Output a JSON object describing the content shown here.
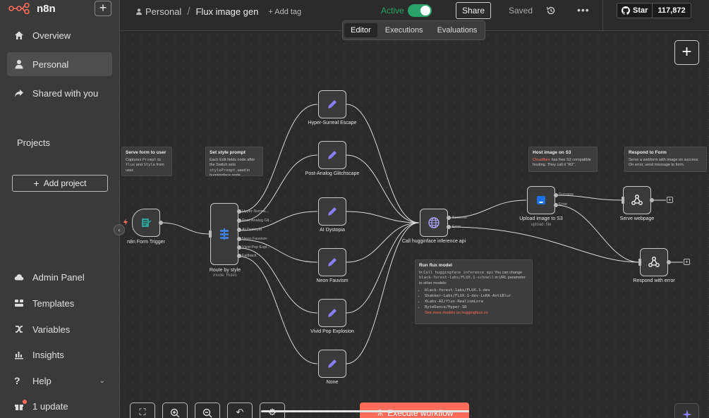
{
  "app": {
    "name": "n8n"
  },
  "sidebar": {
    "items": [
      {
        "label": "Overview",
        "icon": "home-icon"
      },
      {
        "label": "Personal",
        "icon": "user-icon"
      },
      {
        "label": "Shared with you",
        "icon": "share-icon"
      }
    ],
    "projects_label": "Projects",
    "add_project": "Add project",
    "bottom_items": [
      {
        "label": "Admin Panel",
        "icon": "cloud-icon"
      },
      {
        "label": "Templates",
        "icon": "templates-icon"
      },
      {
        "label": "Variables",
        "icon": "variables-icon"
      },
      {
        "label": "Insights",
        "icon": "insights-icon"
      },
      {
        "label": "Help",
        "icon": "help-icon"
      },
      {
        "label": "1 update",
        "icon": "gift-icon"
      }
    ]
  },
  "header": {
    "project": "Personal",
    "workflow_title": "Flux image gen",
    "add_tag": "+ Add tag",
    "active_label": "Active",
    "active": true,
    "share": "Share",
    "saved": "Saved",
    "github": {
      "label": "Star",
      "count": "117,872"
    }
  },
  "tabs": [
    "Editor",
    "Executions",
    "Evaluations"
  ],
  "nodes": {
    "trigger": {
      "label": "n8n Form Trigger"
    },
    "switch": {
      "label": "Route by style",
      "sub": "mode: Rules",
      "outputs": [
        "Hyper-Surrea...",
        "Post-Analog Gli...",
        "AI Dystopia",
        "Neon Fauvism",
        "Vivid Pop Expl...",
        "Fallback"
      ]
    },
    "styles": [
      "Hyper-Surreal Escape",
      "Post-Analog Glitchscape",
      "AI Dystopia",
      "Neon Fauvism",
      "Vivid Pop Explosion",
      "None"
    ],
    "http": {
      "label": "Call hugginface inference api",
      "outputs": [
        "Success",
        "Error"
      ]
    },
    "s3": {
      "label": "Upload image to S3",
      "sub": "upload: file",
      "outputs": [
        "Success",
        "Error"
      ]
    },
    "serve": {
      "label": "Serve webpage"
    },
    "error": {
      "label": "Respond with error"
    }
  },
  "stickies": {
    "form": {
      "title": "Serve form to user",
      "body": [
        "Captures ",
        "Prompt",
        " to ",
        "flux",
        " and ",
        "Style",
        " from user."
      ]
    },
    "style": {
      "title": "Set style prompt",
      "body": [
        "Each Edit fields node after the Switch sets ",
        "stylePrompt",
        ", used in huggingface node."
      ]
    },
    "s3": {
      "title": "Host image on S3",
      "link": "Cloudflare",
      "body": " has free S3 compatible hosting. They call it \"R2\"."
    },
    "respond": {
      "title": "Respond to Form",
      "body": "Serve a webform with image on success. On error, send message to form."
    },
    "flux": {
      "title": "Run flux model",
      "intro": [
        "In ",
        "Call huggingface inference api",
        " You can change ",
        "black-forest-labs/FLUX.1-schnell",
        " in URL parameter to other models:"
      ],
      "models": [
        "black-forest-labs/FLUX.1-dev",
        "Shakker-Labs/FLUX.1-dev-LoRA-AntiBlur",
        "XLabs-AI/flux-RealismLora",
        "ByteDance/Hyper-SD"
      ],
      "link": "See more models on huggingface.co"
    }
  },
  "toolbar": {
    "execute": "Execute workflow"
  },
  "colors": {
    "accent": "#ff6d5a",
    "active": "#29a36a",
    "edit_icon": "#8b7ff5",
    "http_icon": "#a9a3f7",
    "s3_icon": "#1a73e8"
  }
}
